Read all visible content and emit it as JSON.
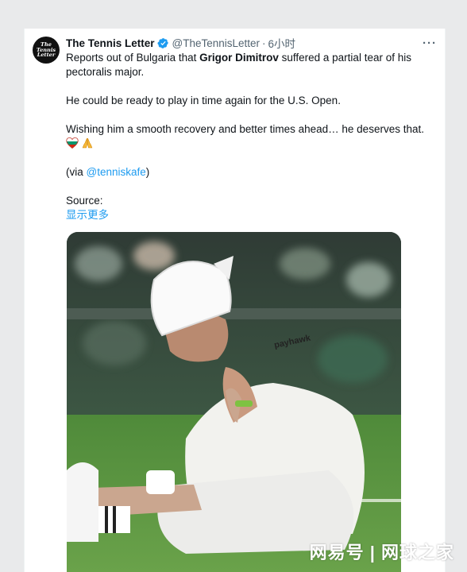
{
  "tweet": {
    "author_name": "The Tennis Letter",
    "handle": "@TheTennisLetter",
    "separator": "·",
    "time": "6小时",
    "more_glyph": "···",
    "avatar_text": "The\nTennis\nLetter",
    "text": {
      "p1_before": "Reports out of Bulgaria that ",
      "p1_bold": "Grigor Dimitrov",
      "p1_after": " suffered a partial tear of his pectoralis major.",
      "p2": "He could be ready to play in time again for the U.S. Open.",
      "p3": "Wishing him a smooth recovery and better times ahead… he deserves that.",
      "p4_before": "(via ",
      "p4_mention": "@tenniskafe",
      "p4_after": ")",
      "source_label": "Source:",
      "show_more": "显示更多"
    },
    "photo": {
      "shirt_brand": "payhawk"
    }
  },
  "watermark": "网易号 | 网球之家",
  "colors": {
    "link": "#1d9bf0",
    "verified": "#1d9bf0",
    "grass": "#5a8f3c"
  },
  "icons": [
    "verified-badge-icon",
    "more-options-icon",
    "heart-flag-emoji-icon",
    "praying-hands-emoji-icon"
  ]
}
